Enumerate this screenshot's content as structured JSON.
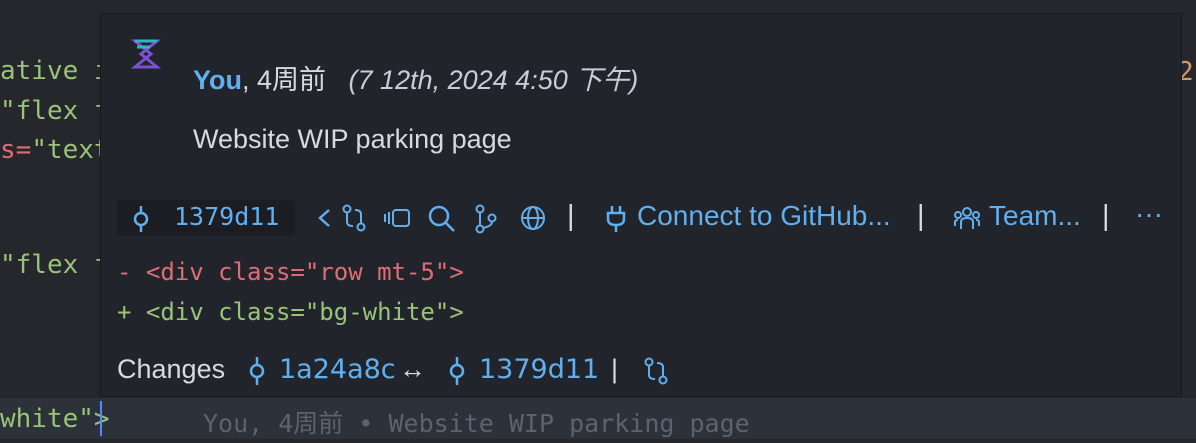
{
  "editor": {
    "lines": [
      {
        "text": "ative i",
        "color": "#98c379"
      },
      {
        "text": "\"flex f",
        "color": "#98c379"
      },
      {
        "prefix": "s=",
        "text": "\"text",
        "color": "#98c379"
      },
      {
        "text": "\"flex f",
        "color": "#98c379"
      },
      {
        "text": "white\">",
        "color": "#98c379"
      }
    ],
    "right_fragment": "2",
    "ghost_blame": "You, 4周前 • Website WIP parking page"
  },
  "hover": {
    "author": "You",
    "relative_time": ", 4周前",
    "date": "(7 12th, 2024 4:50 下午)",
    "message": "Website WIP parking page",
    "sha": "1379d11",
    "connect_label": "Connect to GitHub...",
    "team_label": "Team...",
    "more_label": "···",
    "separator": "|",
    "diff_removed": "- <div class=\"row mt-5\">",
    "diff_added": "+ <div class=\"bg-white\">",
    "changes_label": "Changes",
    "changes_from_sha": "1a24a8c",
    "changes_to_sha": "1379d11",
    "changes_arrow": "↔"
  }
}
